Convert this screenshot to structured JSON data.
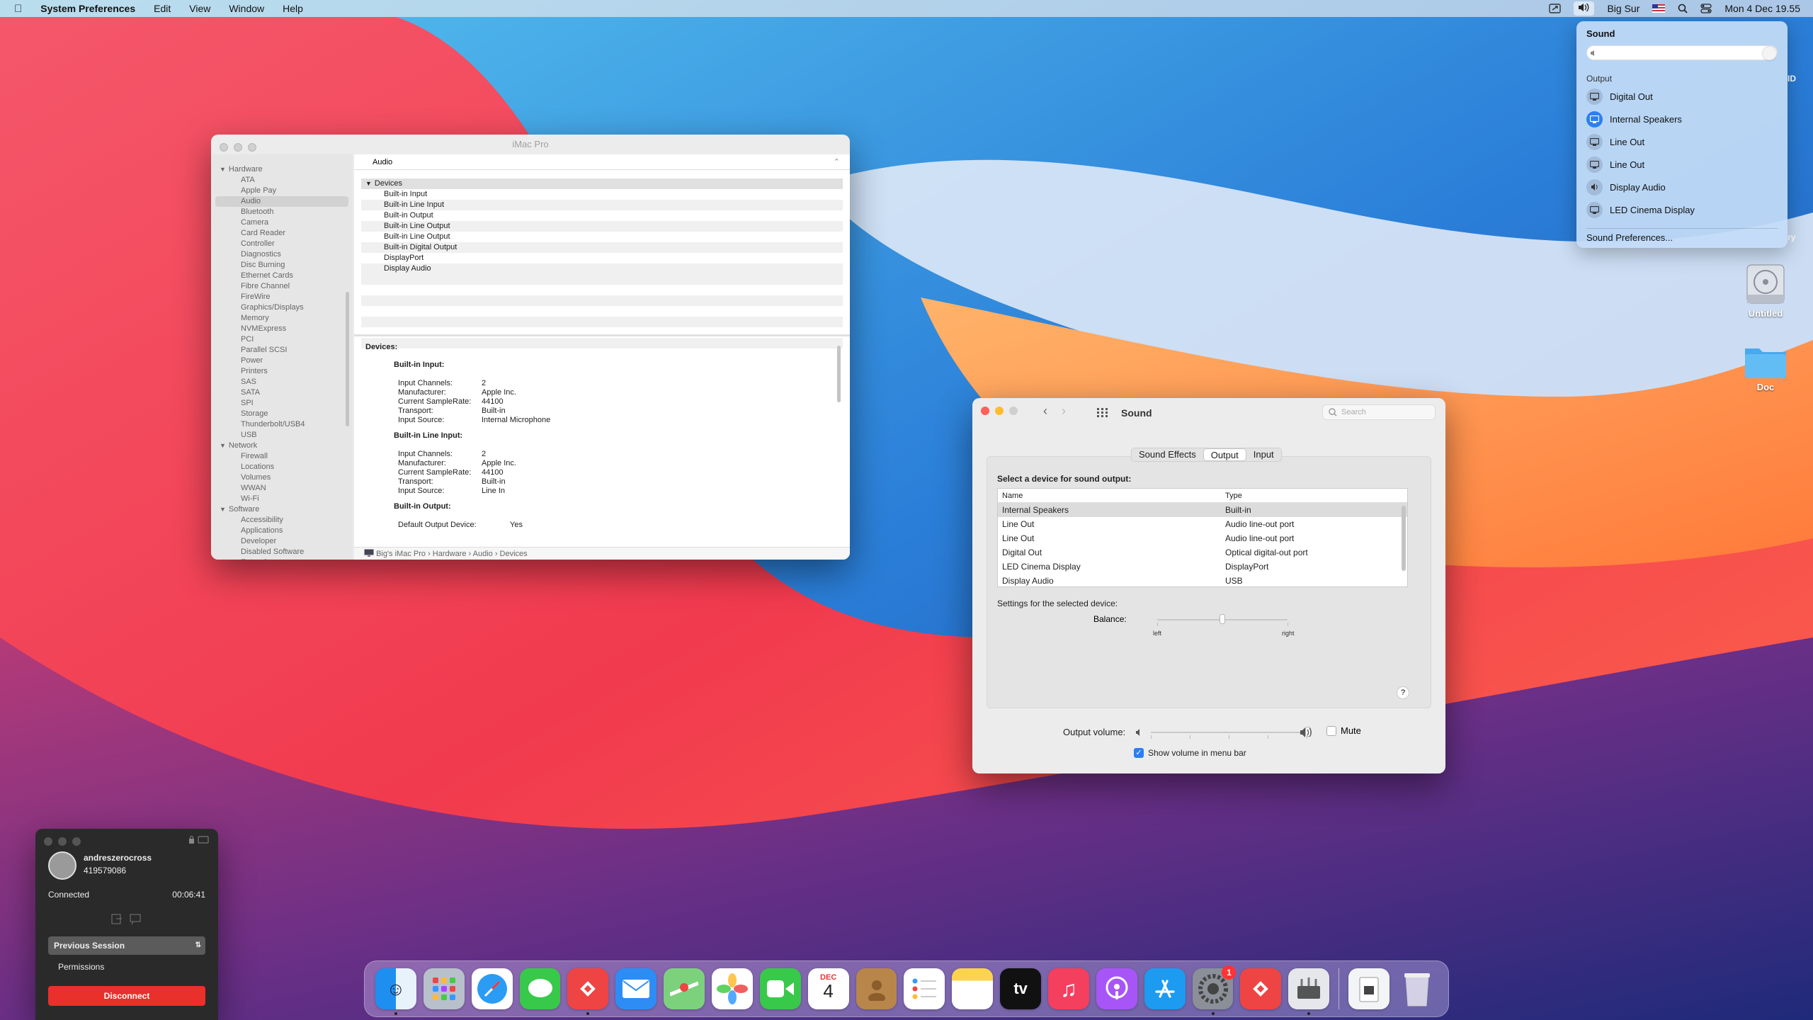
{
  "menubar": {
    "app_name": "System Preferences",
    "menus": [
      "Edit",
      "View",
      "Window",
      "Help"
    ],
    "user": "Big Sur",
    "datetime": "Mon 4 Dec  19.55"
  },
  "sound_menu": {
    "title": "Sound",
    "volume_fraction": 0.97,
    "output_label": "Output",
    "devices": [
      "Digital Out",
      "Internal Speakers",
      "Line Out",
      "Line Out",
      "Display Audio",
      "LED Cinema Display"
    ],
    "selected_index": 1,
    "prefs_label": "Sound Preferences..."
  },
  "desktop": {
    "icons": [
      {
        "label": "Untitled"
      },
      {
        "label": "Doc"
      }
    ],
    "partial_texts": [
      "ID",
      "ry"
    ]
  },
  "sysinfo": {
    "title": "iMac Pro",
    "sidebar": [
      {
        "label": "Hardware",
        "kind": "head"
      },
      {
        "label": "ATA",
        "kind": "item"
      },
      {
        "label": "Apple Pay",
        "kind": "item"
      },
      {
        "label": "Audio",
        "kind": "item",
        "selected": true
      },
      {
        "label": "Bluetooth",
        "kind": "item"
      },
      {
        "label": "Camera",
        "kind": "item"
      },
      {
        "label": "Card Reader",
        "kind": "item"
      },
      {
        "label": "Controller",
        "kind": "item"
      },
      {
        "label": "Diagnostics",
        "kind": "item"
      },
      {
        "label": "Disc Burning",
        "kind": "item"
      },
      {
        "label": "Ethernet Cards",
        "kind": "item"
      },
      {
        "label": "Fibre Channel",
        "kind": "item"
      },
      {
        "label": "FireWire",
        "kind": "item"
      },
      {
        "label": "Graphics/Displays",
        "kind": "item"
      },
      {
        "label": "Memory",
        "kind": "item"
      },
      {
        "label": "NVMExpress",
        "kind": "item"
      },
      {
        "label": "PCI",
        "kind": "item"
      },
      {
        "label": "Parallel SCSI",
        "kind": "item"
      },
      {
        "label": "Power",
        "kind": "item"
      },
      {
        "label": "Printers",
        "kind": "item"
      },
      {
        "label": "SAS",
        "kind": "item"
      },
      {
        "label": "SATA",
        "kind": "item"
      },
      {
        "label": "SPI",
        "kind": "item"
      },
      {
        "label": "Storage",
        "kind": "item"
      },
      {
        "label": "Thunderbolt/USB4",
        "kind": "item"
      },
      {
        "label": "USB",
        "kind": "item"
      },
      {
        "label": "Network",
        "kind": "head"
      },
      {
        "label": "Firewall",
        "kind": "item"
      },
      {
        "label": "Locations",
        "kind": "item"
      },
      {
        "label": "Volumes",
        "kind": "item"
      },
      {
        "label": "WWAN",
        "kind": "item"
      },
      {
        "label": "Wi-Fi",
        "kind": "item"
      },
      {
        "label": "Software",
        "kind": "head"
      },
      {
        "label": "Accessibility",
        "kind": "item"
      },
      {
        "label": "Applications",
        "kind": "item"
      },
      {
        "label": "Developer",
        "kind": "item"
      },
      {
        "label": "Disabled Software",
        "kind": "item"
      },
      {
        "label": "Extensions",
        "kind": "item"
      }
    ],
    "section_header": "Audio",
    "group_label": "Devices",
    "devices": [
      "Built-in Input",
      "Built-in Line Input",
      "Built-in Output",
      "Built-in Line Output",
      "Built-in Line Output",
      "Built-in Digital Output",
      "DisplayPort",
      "Display Audio"
    ],
    "details_header": "Devices:",
    "details": [
      {
        "title": "Built-in Input:",
        "rows": [
          [
            "Input Channels:",
            "2"
          ],
          [
            "Manufacturer:",
            "Apple Inc."
          ],
          [
            "Current SampleRate:",
            "44100"
          ],
          [
            "Transport:",
            "Built-in"
          ],
          [
            "Input Source:",
            "Internal Microphone"
          ]
        ]
      },
      {
        "title": "Built-in Line Input:",
        "rows": [
          [
            "Input Channels:",
            "2"
          ],
          [
            "Manufacturer:",
            "Apple Inc."
          ],
          [
            "Current SampleRate:",
            "44100"
          ],
          [
            "Transport:",
            "Built-in"
          ],
          [
            "Input Source:",
            "Line In"
          ]
        ]
      },
      {
        "title": "Built-in Output:",
        "rows": [
          [
            "Default Output Device:",
            "Yes"
          ]
        ]
      }
    ],
    "path": "Big's iMac Pro  ›  Hardware  ›  Audio  ›  Devices"
  },
  "sound_prefs": {
    "title": "Sound",
    "search_placeholder": "Search",
    "tabs": [
      "Sound Effects",
      "Output",
      "Input"
    ],
    "active_tab": 1,
    "select_label": "Select a device for sound output:",
    "columns": [
      "Name",
      "Type"
    ],
    "rows": [
      {
        "name": "Internal Speakers",
        "type": "Built-in",
        "selected": true
      },
      {
        "name": "Line Out",
        "type": "Audio line-out port"
      },
      {
        "name": "Line Out",
        "type": "Audio line-out port"
      },
      {
        "name": "Digital Out",
        "type": "Optical digital-out port"
      },
      {
        "name": "LED Cinema Display",
        "type": "DisplayPort"
      },
      {
        "name": "Display Audio",
        "type": "USB"
      }
    ],
    "settings_label": "Settings for the selected device:",
    "balance_label": "Balance:",
    "balance_left": "left",
    "balance_right": "right",
    "balance_value": 0.5,
    "help": "?",
    "output_volume_label": "Output volume:",
    "output_volume": 1.0,
    "mute_label": "Mute",
    "mute_checked": false,
    "show_volume_label": "Show volume in menu bar",
    "show_volume_checked": true
  },
  "anydesk": {
    "username": "andreszerocross",
    "id": "419579086",
    "status": "Connected",
    "timer": "00:06:41",
    "session_select": "Previous Session",
    "permissions": "Permissions",
    "disconnect": "Disconnect"
  },
  "dock": {
    "calendar_month": "DEC",
    "calendar_day": "4",
    "tv_label": "tv",
    "badge_count": "1"
  }
}
